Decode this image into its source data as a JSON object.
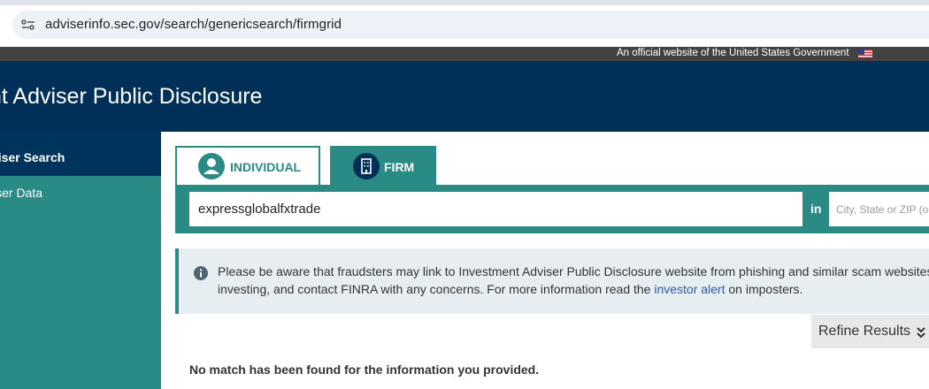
{
  "browser": {
    "url": "adviserinfo.sec.gov/search/genericsearch/firmgrid"
  },
  "gov_banner": {
    "text": "An official website of the United States Government"
  },
  "header": {
    "title": "nt Adviser Public Disclosure"
  },
  "sidebar": {
    "items": [
      {
        "label": "viser Search",
        "active": true
      },
      {
        "label": "iser Data",
        "active": false
      }
    ]
  },
  "tabs": [
    {
      "label": "INDIVIDUAL",
      "icon": "person-icon",
      "active": false
    },
    {
      "label": "FIRM",
      "icon": "building-icon",
      "active": true
    }
  ],
  "search": {
    "value": "expressglobalfxtrade",
    "in_label": "in",
    "location_placeholder": "City, State or ZIP (op"
  },
  "alert": {
    "line1": "Please be aware that fraudsters may link to Investment Adviser Public Disclosure website from phishing and similar scam websites,",
    "line2_before": "investing, and contact FINRA with any concerns. For more information read the ",
    "link_text": "investor alert",
    "line2_after": " on imposters."
  },
  "refine": {
    "label": "Refine Results"
  },
  "results": {
    "message": "No match has been found for the information you provided."
  },
  "colors": {
    "header": "#003057",
    "teal": "#2a8a84",
    "gov_banner": "#424242"
  }
}
